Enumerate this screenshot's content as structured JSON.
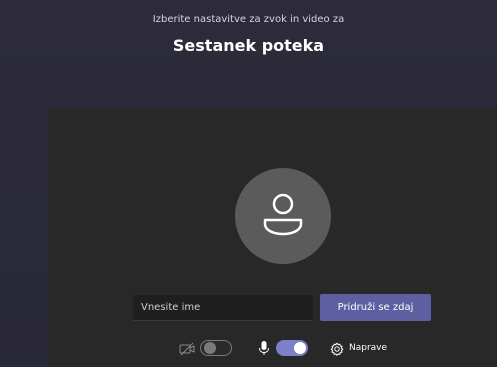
{
  "header": {
    "subtitle": "Izberite nastavitve za zvok in video za",
    "title": "Sestanek poteka"
  },
  "join": {
    "name_placeholder": "Vnesite ime",
    "join_label": "Pridruži se zdaj"
  },
  "controls": {
    "camera_enabled": false,
    "microphone_enabled": true,
    "devices_label": "Naprave"
  },
  "colors": {
    "background": "#2b2a38",
    "panel": "#282828",
    "avatar": "#5b5b5b",
    "join_button": "#5d5fa0",
    "toggle_on": "#7b80c7"
  },
  "icons": {
    "avatar": "person-icon",
    "camera": "camera-off-icon",
    "microphone": "microphone-icon",
    "devices": "gear-icon"
  }
}
